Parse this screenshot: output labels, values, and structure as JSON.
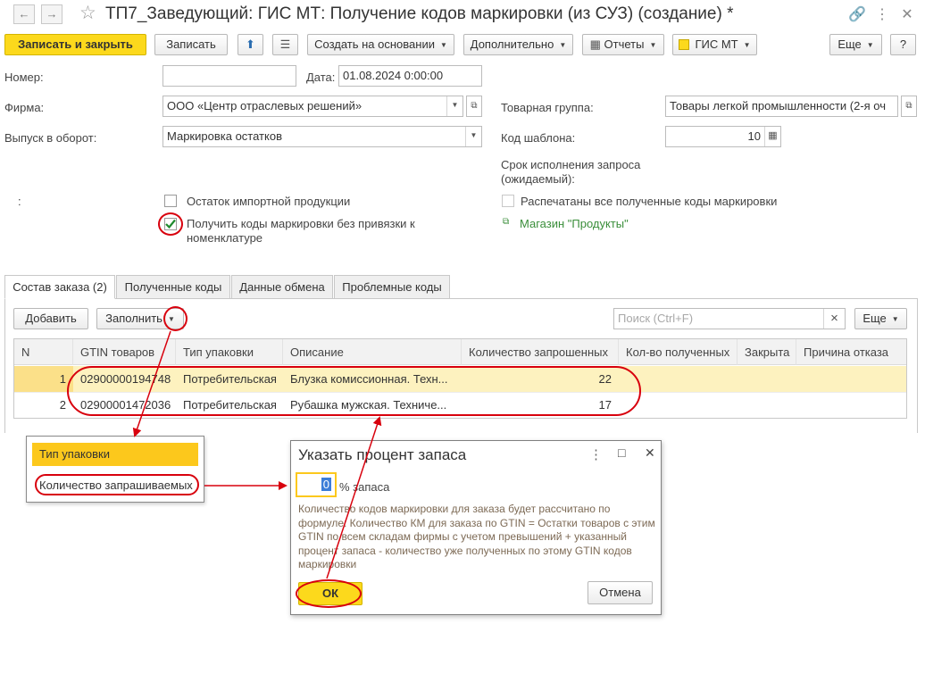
{
  "window": {
    "title": "ТП7_Заведующий: ГИС МТ: Получение кодов маркировки (из СУЗ) (создание) *",
    "back_glyph": "←",
    "forward_glyph": "→",
    "star_glyph": "☆",
    "link_glyph": "🔗",
    "more_glyph": "⋮",
    "maximize_glyph": "□",
    "close_glyph": "✕"
  },
  "toolbar": {
    "save_close": "Записать и закрыть",
    "save": "Записать",
    "upload_glyph": "⬆",
    "list_glyph": "☰",
    "create_based": "Создать на основании",
    "additional": "Дополнительно",
    "reports": "Отчеты",
    "gis_mt": "ГИС МТ",
    "more": "Еще",
    "help": "?"
  },
  "form": {
    "number_label": "Номер:",
    "number_value": "",
    "date_label": "Дата:",
    "date_value": "01.08.2024  0:00:00",
    "company_label": "Фирма:",
    "company_value": "ООО «Центр отраслевых решений»",
    "release_label": "Выпуск в оборот:",
    "release_value": "Маркировка остатков",
    "product_group_label": "Товарная группа:",
    "product_group_value": "Товары легкой промышленности (2-я оч",
    "template_code_label": "Код шаблона:",
    "template_code_value": "10",
    "deadline_label": "Срок исполнения запроса (ожидаемый):",
    "colon_label": ":",
    "import_remainder_label": "Остаток импортной продукции",
    "get_codes_label": "Получить коды маркировки без привязки к номенклатуре",
    "printed_all_label": "Распечатаны все полученные коды маркировки",
    "store_link": "Магазин \"Продукты\""
  },
  "tabs": [
    {
      "label": "Состав заказа (2)"
    },
    {
      "label": "Полученные коды"
    },
    {
      "label": "Данные обмена"
    },
    {
      "label": "Проблемные коды"
    }
  ],
  "table_toolbar": {
    "add": "Добавить",
    "fill": "Заполнить",
    "search_placeholder": "Поиск (Ctrl+F)",
    "clear_glyph": "×",
    "more": "Еще"
  },
  "table": {
    "columns": [
      "N",
      "GTIN товаров",
      "Тип упаковки",
      "Описание",
      "Количество запрошенных",
      "Кол-во полученных",
      "Закрыта",
      "Причина отказа"
    ],
    "rows": [
      {
        "n": "1",
        "gtin": "02900000194748",
        "pack": "Потребительская",
        "desc": "Блузка комиссионная. Техн...",
        "requested": "22",
        "received": "",
        "closed": "",
        "reason": ""
      },
      {
        "n": "2",
        "gtin": "02900001472036",
        "pack": "Потребительская",
        "desc": "Рубашка мужская. Техниче...",
        "requested": "17",
        "received": "",
        "closed": "",
        "reason": ""
      }
    ]
  },
  "fill_menu": {
    "items": [
      "Тип упаковки",
      "Количество запрашиваемых"
    ]
  },
  "dialog": {
    "title": "Указать процент запаса",
    "input_value": "0",
    "percent_label": "% запаса",
    "description": "Количество кодов маркировки для заказа будет рассчитано по формуле: Количество КМ для заказа по GTIN = Остатки товаров с этим GTIN по всем складам фирмы с учетом превышений + указанный процент запаса - количество уже полученных по этому GTIN кодов маркировки",
    "ok": "ОК",
    "cancel": "Отмена"
  },
  "colors": {
    "accent_yellow": "#fcd91c",
    "row_selected": "#fdf2bf",
    "annotation_red": "#d8000d",
    "link_green": "#3a8e3a"
  }
}
